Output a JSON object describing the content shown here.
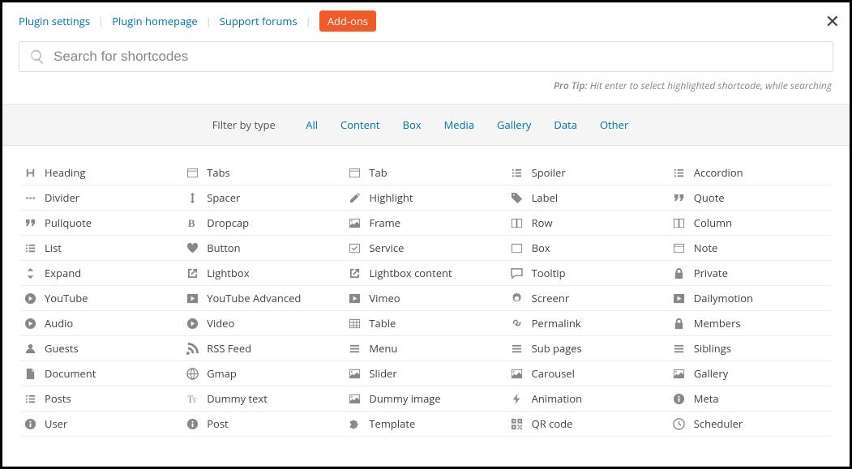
{
  "header": {
    "links": [
      "Plugin settings",
      "Plugin homepage",
      "Support forums"
    ],
    "addons": "Add-ons"
  },
  "search": {
    "placeholder": "Search for shortcodes"
  },
  "tip": {
    "label": "Pro Tip:",
    "text": " Hit enter to select highlighted shortcode, while searching"
  },
  "filter": {
    "label": "Filter by type",
    "items": [
      "All",
      "Content",
      "Box",
      "Media",
      "Gallery",
      "Data",
      "Other"
    ]
  },
  "shortcodes": [
    {
      "icon": "heading",
      "label": "Heading"
    },
    {
      "icon": "tabs",
      "label": "Tabs"
    },
    {
      "icon": "tab",
      "label": "Tab"
    },
    {
      "icon": "spoiler",
      "label": "Spoiler"
    },
    {
      "icon": "accordion",
      "label": "Accordion"
    },
    {
      "icon": "divider",
      "label": "Divider"
    },
    {
      "icon": "spacer",
      "label": "Spacer"
    },
    {
      "icon": "highlight",
      "label": "Highlight"
    },
    {
      "icon": "label",
      "label": "Label"
    },
    {
      "icon": "quote",
      "label": "Quote"
    },
    {
      "icon": "pullquote",
      "label": "Pullquote"
    },
    {
      "icon": "dropcap",
      "label": "Dropcap"
    },
    {
      "icon": "frame",
      "label": "Frame"
    },
    {
      "icon": "row",
      "label": "Row"
    },
    {
      "icon": "column",
      "label": "Column"
    },
    {
      "icon": "list",
      "label": "List"
    },
    {
      "icon": "button",
      "label": "Button"
    },
    {
      "icon": "service",
      "label": "Service"
    },
    {
      "icon": "box",
      "label": "Box"
    },
    {
      "icon": "note",
      "label": "Note"
    },
    {
      "icon": "expand",
      "label": "Expand"
    },
    {
      "icon": "lightbox",
      "label": "Lightbox"
    },
    {
      "icon": "lightbox-content",
      "label": "Lightbox content"
    },
    {
      "icon": "tooltip",
      "label": "Tooltip"
    },
    {
      "icon": "private",
      "label": "Private"
    },
    {
      "icon": "youtube",
      "label": "YouTube"
    },
    {
      "icon": "youtube-adv",
      "label": "YouTube Advanced"
    },
    {
      "icon": "vimeo",
      "label": "Vimeo"
    },
    {
      "icon": "screenr",
      "label": "Screenr"
    },
    {
      "icon": "dailymotion",
      "label": "Dailymotion"
    },
    {
      "icon": "audio",
      "label": "Audio"
    },
    {
      "icon": "video",
      "label": "Video"
    },
    {
      "icon": "table",
      "label": "Table"
    },
    {
      "icon": "permalink",
      "label": "Permalink"
    },
    {
      "icon": "members",
      "label": "Members"
    },
    {
      "icon": "guests",
      "label": "Guests"
    },
    {
      "icon": "rss",
      "label": "RSS Feed"
    },
    {
      "icon": "menu",
      "label": "Menu"
    },
    {
      "icon": "subpages",
      "label": "Sub pages"
    },
    {
      "icon": "siblings",
      "label": "Siblings"
    },
    {
      "icon": "document",
      "label": "Document"
    },
    {
      "icon": "gmap",
      "label": "Gmap"
    },
    {
      "icon": "slider",
      "label": "Slider"
    },
    {
      "icon": "carousel",
      "label": "Carousel"
    },
    {
      "icon": "gallery",
      "label": "Gallery"
    },
    {
      "icon": "posts",
      "label": "Posts"
    },
    {
      "icon": "dummytext",
      "label": "Dummy text"
    },
    {
      "icon": "dummyimage",
      "label": "Dummy image"
    },
    {
      "icon": "animation",
      "label": "Animation"
    },
    {
      "icon": "meta",
      "label": "Meta"
    },
    {
      "icon": "user",
      "label": "User"
    },
    {
      "icon": "post",
      "label": "Post"
    },
    {
      "icon": "template",
      "label": "Template"
    },
    {
      "icon": "qrcode",
      "label": "QR code"
    },
    {
      "icon": "scheduler",
      "label": "Scheduler"
    }
  ]
}
